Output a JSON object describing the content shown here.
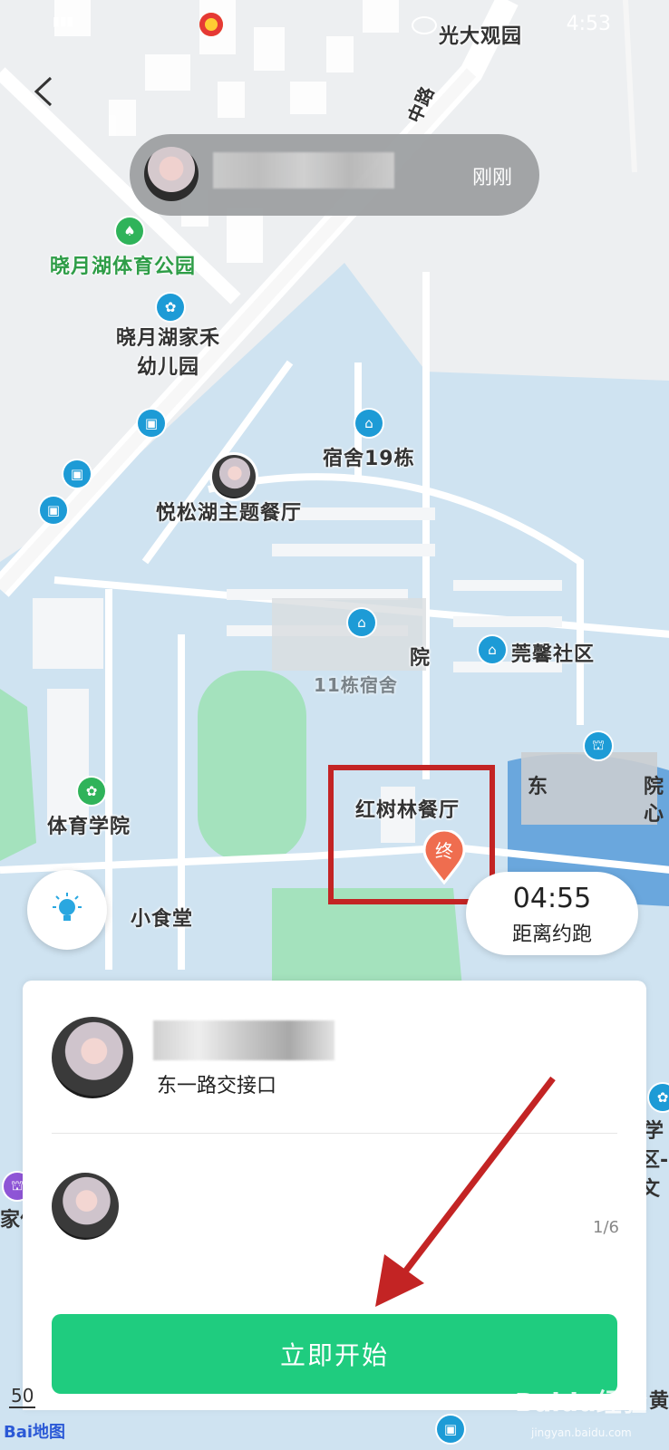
{
  "status_bar": {
    "weibo_icon": "weibo-icon",
    "time": "4:53"
  },
  "map": {
    "top_label": "光大观园",
    "road_label": "中路",
    "labels": {
      "park": "晓月湖体育公园",
      "kindergarten": "晓月湖家禾\n幼儿园",
      "dorm": "宿舍19栋",
      "restaurant_1": "悦松湖主题餐厅",
      "college_partial": "院",
      "dorm_partial": "11栋宿舍",
      "community": "莞馨社区",
      "restaurant_2": "红树林餐厅",
      "pe_college": "体育学院",
      "canteen": "小食堂",
      "edge_right_1": "学",
      "edge_right_2": "区-文",
      "edge_left": "家便",
      "edge_bottom_right": "黄",
      "partial_right": "东",
      "partial_right_2": "院",
      "partial_right_3": "心"
    },
    "end_pin_label": "终",
    "scale_text": "50",
    "logo_text": "Bai地图"
  },
  "toast": {
    "time": "刚刚"
  },
  "timer": {
    "value": "04:55",
    "label": "距离约跑"
  },
  "sheet": {
    "location": "东一路交接口",
    "page": "1/6",
    "start_button": "立即开始"
  },
  "watermark": {
    "text": "Baidu经验",
    "sub": "jingyan.baidu.com"
  },
  "colors": {
    "accent": "#1fcc7f",
    "highlight": "#c32424",
    "pin": "#ef6d4f"
  }
}
